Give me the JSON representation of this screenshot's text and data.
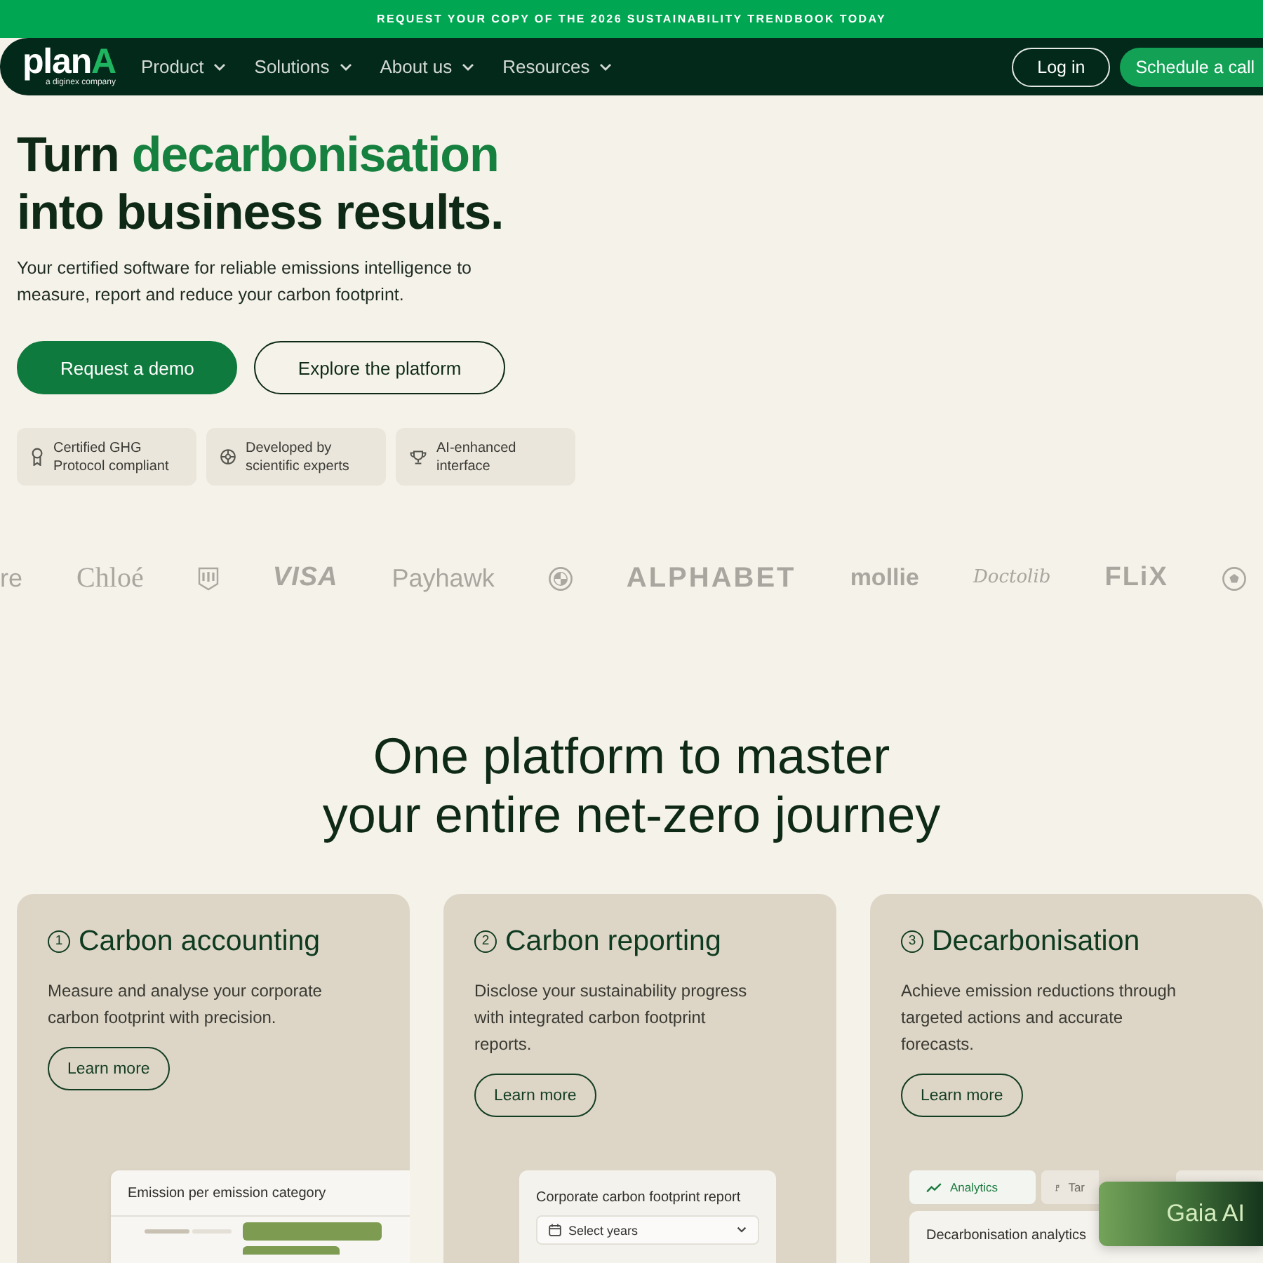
{
  "announcement": {
    "text": "REQUEST YOUR COPY OF THE 2026 SUSTAINABILITY TRENDBOOK TODAY"
  },
  "navbar": {
    "logo": {
      "wordmark": "plan",
      "accent": "A",
      "tagline": "a diginex company"
    },
    "menu": [
      {
        "label": "Product"
      },
      {
        "label": "Solutions"
      },
      {
        "label": "About us"
      },
      {
        "label": "Resources"
      }
    ],
    "login": "Log in",
    "cta": "Schedule a call"
  },
  "hero": {
    "title": {
      "before": "Turn ",
      "highlight": "decarbonisation",
      "after": "\ninto business results."
    },
    "subtitle": "Your certified software for reliable emissions intelligence to measure, report and reduce your carbon footprint.",
    "buttons": [
      {
        "label": "Request a demo",
        "kind": "primary"
      },
      {
        "label": "Explore the platform",
        "kind": "outline"
      }
    ],
    "features": [
      {
        "text": "Certified GHG Protocol compliant"
      },
      {
        "text": "Developed by scientific experts"
      },
      {
        "text": "AI-enhanced interface"
      }
    ]
  },
  "logos": [
    {
      "kind": "sans",
      "text": "re"
    },
    {
      "kind": "serif",
      "text": "Chloé"
    },
    {
      "kind": "emblem"
    },
    {
      "kind": "slanted",
      "text": "VISA"
    },
    {
      "kind": "sans",
      "text": "Payhawk"
    },
    {
      "kind": "roundel"
    },
    {
      "kind": "wide",
      "text": "ALPHABET"
    },
    {
      "kind": "rounded",
      "text": "mollie"
    },
    {
      "kind": "script",
      "text": "Doctolib"
    },
    {
      "kind": "heavy",
      "text": "FLiX"
    },
    {
      "kind": "ball"
    }
  ],
  "platform": {
    "heading": "One platform to master\nyour entire net-zero journey",
    "cards": [
      {
        "number": "1",
        "title": "Carbon accounting",
        "text": "Measure and analyse your corporate carbon footprint with precision.",
        "link": "Learn more",
        "preview": {
          "kind": "bars",
          "title": "Emission per emission category"
        }
      },
      {
        "number": "2",
        "title": "Carbon reporting",
        "text": "Disclose your sustainability progress with integrated carbon footprint reports.",
        "link": "Learn more",
        "preview": {
          "kind": "report",
          "title": "Corporate carbon footprint report",
          "select": {
            "label": "Select years"
          }
        }
      },
      {
        "number": "3",
        "title": "Decarbonisation",
        "text": "Achieve emission reductions through targeted actions and accurate forecasts.",
        "link": "Learn more",
        "preview": {
          "kind": "analytics",
          "tabs": [
            {
              "label": "Analytics",
              "selected": true
            },
            {
              "label": "Tar",
              "selected": false
            },
            {
              "selected": false
            }
          ],
          "title": "Decarbonisation analytics"
        }
      }
    ]
  },
  "chat_widget": {
    "label": "Gaia AI"
  }
}
